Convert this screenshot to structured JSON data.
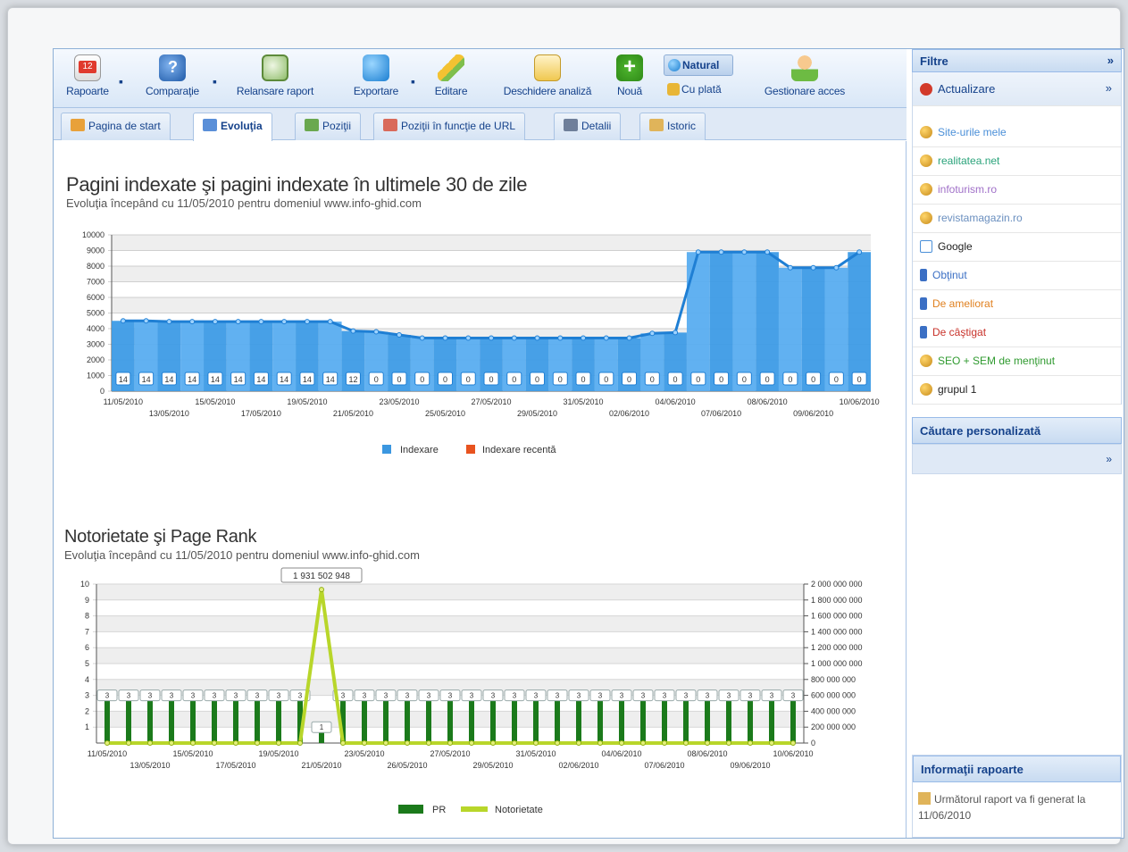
{
  "toolbar": {
    "buttons": [
      {
        "label": "Rapoarte",
        "icon": "calendar-icon"
      },
      {
        "label": "Comparaţie",
        "icon": "compare-icon"
      },
      {
        "label": "Relansare raport",
        "icon": "relaunch-icon"
      },
      {
        "label": "Exportare",
        "icon": "globe-export-icon"
      },
      {
        "label": "Editare",
        "icon": "pencil-icon"
      },
      {
        "label": "Deschidere analiză",
        "icon": "open-folder-icon"
      },
      {
        "label": "Nouă",
        "icon": "plus-icon"
      },
      {
        "label": "Gestionare acces",
        "icon": "user-icon"
      }
    ],
    "natural_label": "Natural",
    "paid_label": "Cu plată"
  },
  "tabs": [
    {
      "label": "Pagina de start"
    },
    {
      "label": "Evoluţia"
    },
    {
      "label": "Poziţii"
    },
    {
      "label": "Poziţii în funcţie de URL"
    },
    {
      "label": "Detalii"
    },
    {
      "label": "Istoric"
    }
  ],
  "chart1": {
    "title": "Pagini indexate şi pagini indexate în ultimele 30 de zile",
    "subtitle": "Evoluţia începând cu 11/05/2010 pentru domeniul www.info-ghid.com",
    "legend": [
      "Indexare",
      "Indexare recentă"
    ],
    "colors": {
      "indexare": "#3b97e0",
      "recent": "#e8531f"
    }
  },
  "chart2": {
    "title": "Notorietate şi Page Rank",
    "subtitle": "Evoluţia începând cu 11/05/2010 pentru domeniul www.info-ghid.com",
    "tooltip": "1 931 502 948",
    "legend": [
      "PR",
      "Notorietate"
    ],
    "colors": {
      "pr": "#1b7a1b",
      "notorietate": "#b8d62a"
    }
  },
  "chart_data": [
    {
      "type": "area",
      "title": "Pagini indexate şi pagini indexate în ultimele 30 de zile",
      "ylim": [
        0,
        10000
      ],
      "yticks": [
        0,
        1000,
        2000,
        3000,
        4000,
        5000,
        6000,
        7000,
        8000,
        9000,
        10000
      ],
      "x_ticks_top": [
        "11/05/2010",
        "15/05/2010",
        "19/05/2010",
        "23/05/2010",
        "27/05/2010",
        "31/05/2010",
        "04/06/2010",
        "08/06/2010",
        "10/06/2010"
      ],
      "x_ticks_bottom": [
        "13/05/2010",
        "17/05/2010",
        "21/05/2010",
        "25/05/2010",
        "29/05/2010",
        "02/06/2010",
        "07/06/2010",
        "09/06/2010"
      ],
      "series": [
        {
          "name": "Indexare",
          "values": [
            4500,
            4500,
            4450,
            4450,
            4450,
            4450,
            4450,
            4450,
            4450,
            4450,
            3850,
            3800,
            3600,
            3400,
            3400,
            3400,
            3400,
            3400,
            3400,
            3400,
            3400,
            3400,
            3400,
            3700,
            3750,
            8900,
            8900,
            8900,
            8900,
            7900,
            7900,
            7900,
            8900
          ]
        },
        {
          "name": "Indexare recentă",
          "values": [
            14,
            14,
            14,
            14,
            14,
            14,
            14,
            14,
            14,
            14,
            12,
            0,
            0,
            0,
            0,
            0,
            0,
            0,
            0,
            0,
            0,
            0,
            0,
            0,
            0,
            0,
            0,
            0,
            0,
            0,
            0,
            0,
            0
          ]
        }
      ]
    },
    {
      "type": "line",
      "title": "Notorietate şi Page Rank",
      "ylim_left": [
        0,
        10
      ],
      "yticks_left": [
        1,
        2,
        3,
        4,
        5,
        6,
        7,
        8,
        9,
        10
      ],
      "ylim_right": [
        0,
        2000000000
      ],
      "yticks_right": [
        "0",
        "200 000 000",
        "400 000 000",
        "600 000 000",
        "800 000 000",
        "1 000 000 000",
        "1 200 000 000",
        "1 400 000 000",
        "1 600 000 000",
        "1 800 000 000",
        "2 000 000 000"
      ],
      "x_ticks_top": [
        "11/05/2010",
        "15/05/2010",
        "19/05/2010",
        "23/05/2010",
        "27/05/2010",
        "31/05/2010",
        "04/06/2010",
        "08/06/2010",
        "10/06/2010"
      ],
      "x_ticks_bottom": [
        "13/05/2010",
        "17/05/2010",
        "21/05/2010",
        "26/05/2010",
        "29/05/2010",
        "02/06/2010",
        "07/06/2010",
        "09/06/2010"
      ],
      "series": [
        {
          "name": "PR",
          "values": [
            3,
            3,
            3,
            3,
            3,
            3,
            3,
            3,
            3,
            3,
            1,
            3,
            3,
            3,
            3,
            3,
            3,
            3,
            3,
            3,
            3,
            3,
            3,
            3,
            3,
            3,
            3,
            3,
            3,
            3,
            3,
            3,
            3
          ]
        },
        {
          "name": "Notorietate",
          "values": [
            0,
            0,
            0,
            0,
            0,
            0,
            0,
            0,
            0,
            0,
            1931502948,
            0,
            0,
            0,
            0,
            0,
            0,
            0,
            0,
            0,
            0,
            0,
            0,
            0,
            0,
            0,
            0,
            0,
            0,
            0,
            0,
            0,
            0
          ]
        }
      ]
    }
  ],
  "panel": {
    "filters_title": "Filtre",
    "refresh_label": "Actualizare",
    "items": [
      {
        "label": "Site-urile mele",
        "color": "#4a8fd8",
        "icon": "coin-icon"
      },
      {
        "label": "realitatea.net",
        "color": "#2aa37a",
        "icon": "coin-icon"
      },
      {
        "label": "infoturism.ro",
        "color": "#a070c8",
        "icon": "coin-icon"
      },
      {
        "label": "revistamagazin.ro",
        "color": "#6a8fbf",
        "icon": "coin-icon"
      },
      {
        "label": "Google",
        "color": "#222222",
        "icon": "google-icon"
      },
      {
        "label": "Obţinut",
        "color": "#3b6fc4",
        "icon": "arrow-icon"
      },
      {
        "label": "De ameliorat",
        "color": "#e0801f",
        "icon": "arrow-icon"
      },
      {
        "label": "De câştigat",
        "color": "#c8322a",
        "icon": "arrow-icon"
      },
      {
        "label": "SEO + SEM de menţinut",
        "color": "#2f9a2f",
        "icon": "coin-icon"
      },
      {
        "label": "grupul 1",
        "color": "#222222",
        "icon": "coin-icon"
      }
    ],
    "search_title": "Căutare personalizată",
    "info_title": "Informaţii rapoarte",
    "info_text": "Următorul raport va fi generat la 11/06/2010"
  }
}
